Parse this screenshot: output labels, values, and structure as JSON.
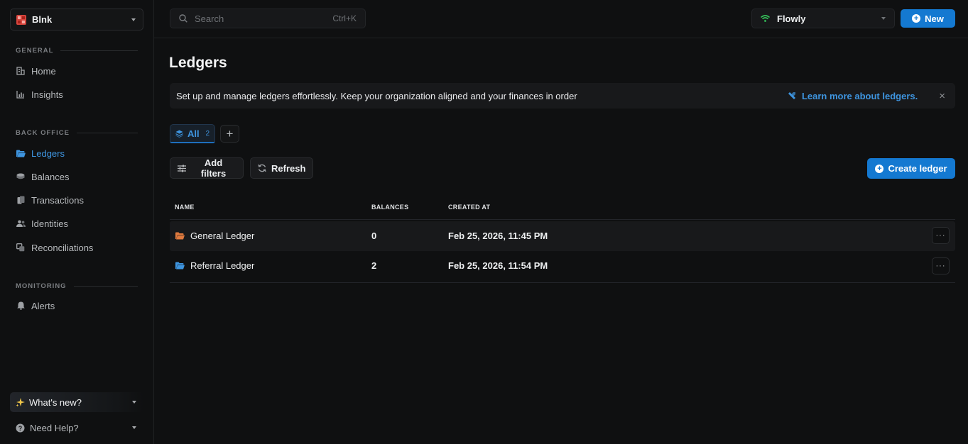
{
  "sidebar": {
    "workspace": "Blnk",
    "sections": {
      "general": "GENERAL",
      "back_office": "BACK OFFICE",
      "monitoring": "MONITORING"
    },
    "items": {
      "home": "Home",
      "insights": "Insights",
      "ledgers": "Ledgers",
      "balances": "Balances",
      "transactions": "Transactions",
      "identities": "Identities",
      "reconciliations": "Reconciliations",
      "alerts": "Alerts"
    },
    "whats_new": "What's new?",
    "need_help": "Need Help?"
  },
  "topbar": {
    "search_placeholder": "Search",
    "search_shortcut": "Ctrl+K",
    "org_name": "Flowly",
    "new_button": "New"
  },
  "page": {
    "title": "Ledgers",
    "banner_text": "Set up and manage ledgers effortlessly. Keep your organization aligned and your finances in order",
    "banner_link": "Learn more about ledgers.",
    "tab_all": "All",
    "tab_all_count": "2",
    "add_filters": "Add filters",
    "refresh": "Refresh",
    "create_ledger": "Create ledger"
  },
  "table": {
    "columns": [
      "NAME",
      "BALANCES",
      "CREATED AT"
    ],
    "rows": [
      {
        "name": "General Ledger",
        "balances": "0",
        "created_at": "Feb 25, 2026, 11:45 PM",
        "icon_color": "#e07a3e"
      },
      {
        "name": "Referral Ledger",
        "balances": "2",
        "created_at": "Feb 25, 2026, 11:54 PM",
        "icon_color": "#3e95e0"
      }
    ]
  },
  "colors": {
    "accent": "#1479d1",
    "link": "#3e95e0",
    "background": "#0f1011",
    "org_status": "#35c25a"
  }
}
